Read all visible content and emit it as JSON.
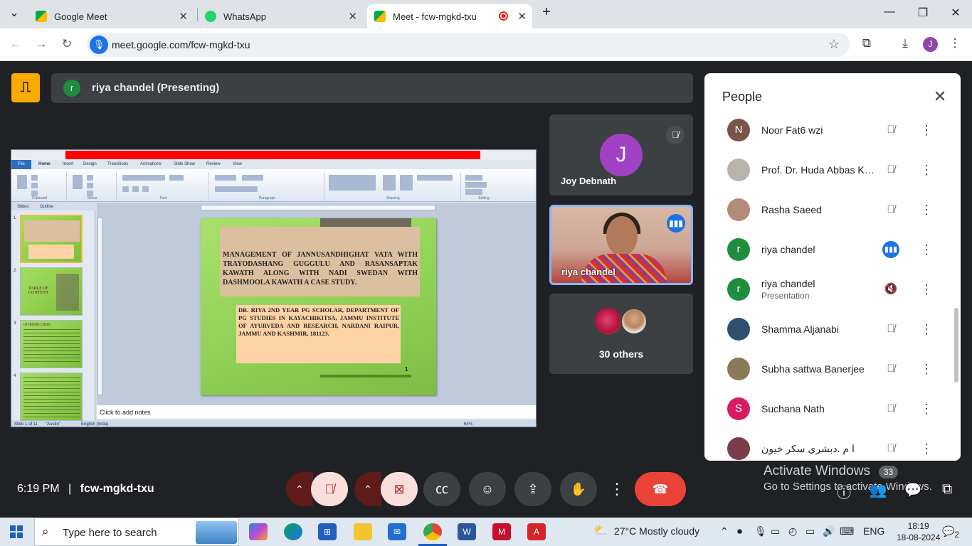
{
  "browser": {
    "tabs": [
      {
        "title": "Google Meet",
        "active": false,
        "icon": "meet-icon"
      },
      {
        "title": "WhatsApp",
        "active": false,
        "icon": "whatsapp-icon"
      },
      {
        "title": "Meet - fcw-mgkd-txu",
        "active": true,
        "icon": "meet-icon",
        "recording": true
      }
    ],
    "url": "meet.google.com/fcw-mgkd-txu",
    "profile_initial": "J",
    "colors": {
      "tabbar": "#dfe3e8",
      "accent": "#1a73e8"
    }
  },
  "meet": {
    "presenter_initial": "r",
    "presenter_label": "riya chandel (Presenting)",
    "time": "6:19 PM",
    "separator": "|",
    "code": "fcw-mgkd-txu",
    "tiles": {
      "joy": {
        "initial": "J",
        "name": "Joy Debnath",
        "muted": true
      },
      "riya": {
        "name": "riya chandel",
        "speaking": true
      },
      "others": {
        "label": "30 others"
      }
    },
    "people_panel": {
      "title": "People",
      "participants": [
        {
          "name": "Noor Fat6 wzi",
          "initial": "N",
          "color": "#795548",
          "mic": "muted"
        },
        {
          "name": "Prof. Dr. Huda Abbas Ka...",
          "initial": "",
          "color": "#b9b3ad",
          "mic": "muted"
        },
        {
          "name": "Rasha Saeed",
          "initial": "",
          "color": "#b48b7b",
          "mic": "muted"
        },
        {
          "name": "riya chandel",
          "initial": "r",
          "color": "#1e8e3e",
          "mic": "speaking"
        },
        {
          "name": "riya chandel",
          "sub": "Presentation",
          "initial": "r",
          "color": "#1e8e3e",
          "mic": "audio-off"
        },
        {
          "name": "Shamma Aljanabi",
          "initial": "",
          "color": "#2f4f6f",
          "mic": "muted"
        },
        {
          "name": "Subha sattwa Banerjee",
          "initial": "",
          "color": "#8a7a5a",
          "mic": "muted"
        },
        {
          "name": "Suchana Nath",
          "initial": "S",
          "color": "#d81b60",
          "mic": "muted"
        },
        {
          "name": "ا م .دبشری سکر خیون",
          "initial": "",
          "color": "#7a3b4b",
          "mic": "muted"
        }
      ]
    },
    "controls": {
      "end_color": "#ea4335",
      "muted_bg": "#f9dedc"
    },
    "watermark": {
      "line1": "Activate Windows",
      "line2": "Go to Settings to activate Windows.",
      "participants_badge": "33"
    }
  },
  "presentation": {
    "ribbon_tabs": [
      "File",
      "Home",
      "Insert",
      "Design",
      "Transitions",
      "Animations",
      "Slide Show",
      "Review",
      "View"
    ],
    "ribbon_groups": [
      "Clipboard",
      "Slides",
      "Font",
      "Paragraph",
      "Drawing",
      "Editing"
    ],
    "panel_tabs": [
      "Slides",
      "Outline"
    ],
    "thumbnails": [
      {
        "num": "1",
        "text": ""
      },
      {
        "num": "2",
        "text": "TABLE OF CONTENT"
      },
      {
        "num": "3",
        "text": "INTRODUCTION"
      },
      {
        "num": "4",
        "text": ""
      }
    ],
    "slide": {
      "title": "MANAGEMENT OF JANNUSANDHIGHAT VATA WITH TRAYODASHANG GUGGULU AND RASANSAPTAK KAWATH ALONG WITH NADI SWEDAN WITH DASHMOOLA KAWATH A CASE STUDY.",
      "author": "DR. RIYA 2ND YEAR PG SCHOLAR, DEPARTMENT OF PG STUDIES IN KAYACHIKITSA, JAMMU INSTITUTE OF AYURVEDA AND RESEARCH, NARDANI RAIPUR, JAMMU AND KASHMIR, 181123.",
      "number": "1"
    },
    "notes_placeholder": "Click to add notes",
    "status": {
      "slide": "Slide 1 of 11",
      "theme": "\"Austin\"",
      "language": "English (India)",
      "zoom": "64%"
    }
  },
  "taskbar": {
    "search_placeholder": "Type here to search",
    "weather": "27°C  Mostly cloudy",
    "lang": "ENG",
    "time": "18:19",
    "date": "18-08-2024",
    "notifications": "2"
  }
}
